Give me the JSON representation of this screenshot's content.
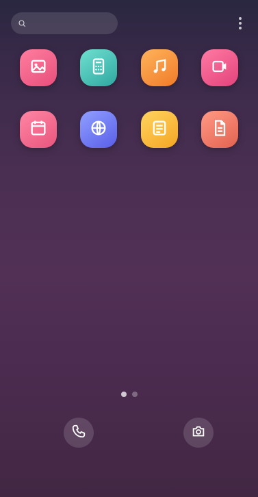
{
  "header": {
    "search_placeholder": "",
    "more_icon": "more-vertical-icon"
  },
  "apps": [
    {
      "label": "",
      "icon": "gallery-icon",
      "color": "#f26a8d"
    },
    {
      "label": "",
      "icon": "calculator-icon",
      "color": "#4fc3b7"
    },
    {
      "label": "",
      "icon": "music-icon",
      "color": "#ff9a3c"
    },
    {
      "label": "",
      "icon": "video-icon",
      "color": "#f25e8c"
    },
    {
      "label": "",
      "icon": "calendar-icon",
      "color": "#f26a8d"
    },
    {
      "label": "",
      "icon": "browser-icon",
      "color": "#6c7bff"
    },
    {
      "label": "",
      "icon": "notes-icon",
      "color": "#ffbf3c"
    },
    {
      "label": "",
      "icon": "docs-icon",
      "color": "#f07b6a"
    }
  ],
  "pager": {
    "pages": 2,
    "active_index": 0
  },
  "dock": [
    {
      "label": "",
      "icon": "phone-icon"
    },
    {
      "label": "",
      "icon": "camera-icon"
    }
  ]
}
